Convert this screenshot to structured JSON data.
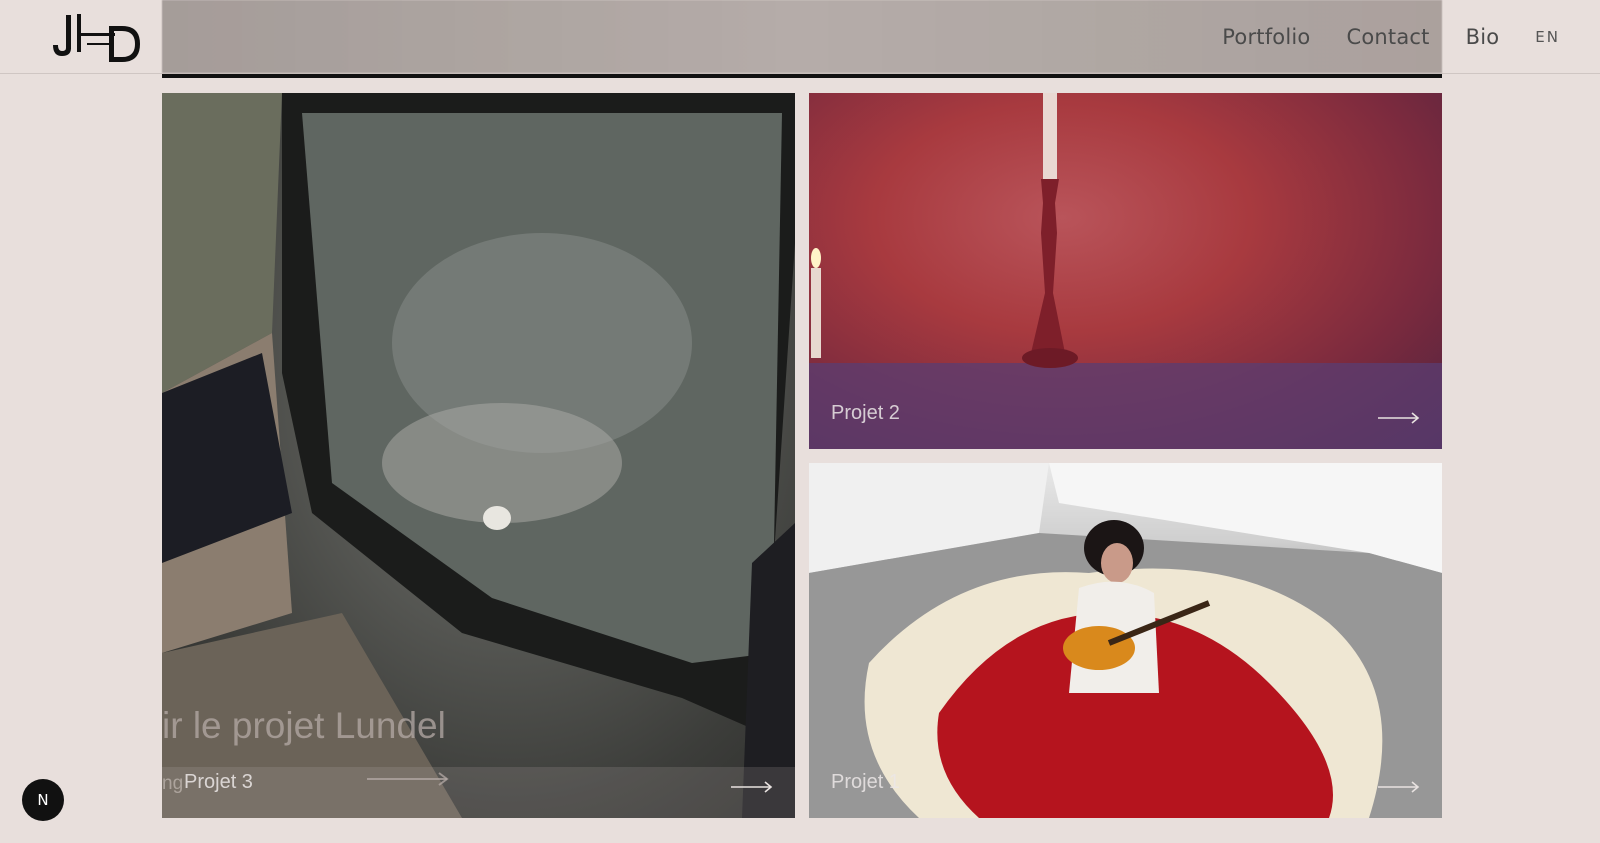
{
  "header": {
    "logo_alt": "JHD",
    "nav": {
      "portfolio": "Portfolio",
      "contact": "Contact",
      "bio": "Bio",
      "lang": "EN"
    }
  },
  "projects": [
    {
      "label": "Projet 3",
      "overlay_text": "ir le projet Lundel",
      "overlay_small": "ng"
    },
    {
      "label": "Projet 2"
    },
    {
      "label": "Projet 1"
    }
  ],
  "badge": {
    "text": "N"
  },
  "colors": {
    "background": "#e8dfdc",
    "nav_text": "#4a4a4a",
    "badge": "#111111"
  }
}
